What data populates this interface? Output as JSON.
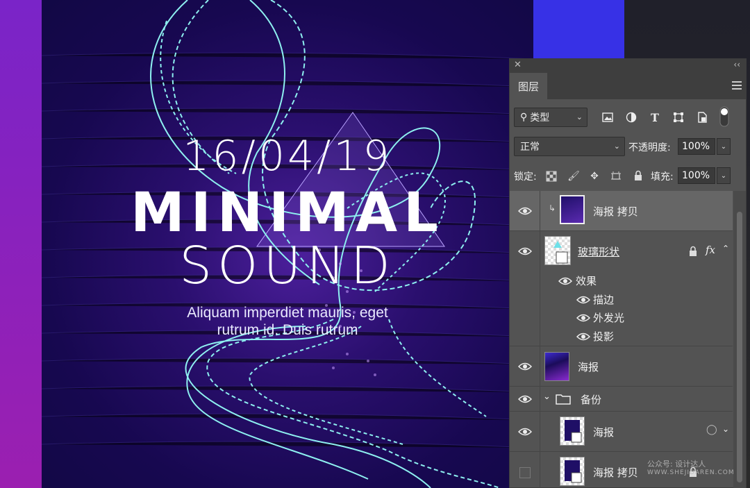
{
  "poster": {
    "date": "16/04/19",
    "title_line1": "MINIMAL",
    "title_line2": "SOUND",
    "subtitle_line1": "Aliquam imperdiet mauris, eget",
    "subtitle_line2": "rutrum id. Duis rutrum"
  },
  "panel": {
    "close_glyph": "✕",
    "collapse_glyph": "‹‹",
    "tab_label": "图层",
    "filter": {
      "type_label": "类型",
      "icons": [
        "image-filter-icon",
        "adjustment-filter-icon",
        "type-filter-icon",
        "shape-filter-icon",
        "smart-object-filter-icon",
        "filter-toggle-icon"
      ]
    },
    "blend_mode": "正常",
    "opacity_label": "不透明度:",
    "opacity_value": "100%",
    "lock_label": "锁定:",
    "fill_label": "填充:",
    "fill_value": "100%",
    "layers": [
      {
        "name": "海报 拷贝",
        "visible": true,
        "selected": true,
        "clipped": true,
        "type": "smart-object"
      },
      {
        "name": "玻璃形状",
        "visible": true,
        "locked": true,
        "fx": "fx",
        "type": "shape"
      },
      {
        "name": "效果",
        "visible": true,
        "type": "effects-header"
      },
      {
        "name": "描边",
        "visible": true,
        "type": "effect"
      },
      {
        "name": "外发光",
        "visible": true,
        "type": "effect"
      },
      {
        "name": "投影",
        "visible": true,
        "type": "effect"
      },
      {
        "name": "海报",
        "visible": true,
        "type": "raster"
      },
      {
        "name": "备份",
        "visible": true,
        "type": "group"
      },
      {
        "name": "海报",
        "visible": true,
        "type": "smart-object",
        "indented": true
      },
      {
        "name": "海报 拷贝",
        "visible": false,
        "type": "smart-object",
        "indented": true
      }
    ]
  },
  "watermark": {
    "line1": "公众号: 设计达人",
    "line2": "WWW.SHEJIDAREN.COM"
  },
  "colors": {
    "poster_bg": "#170850",
    "accent_cyan": "#8ef0f0",
    "panel_bg": "#535353",
    "blue_bar": "#3731e6"
  }
}
